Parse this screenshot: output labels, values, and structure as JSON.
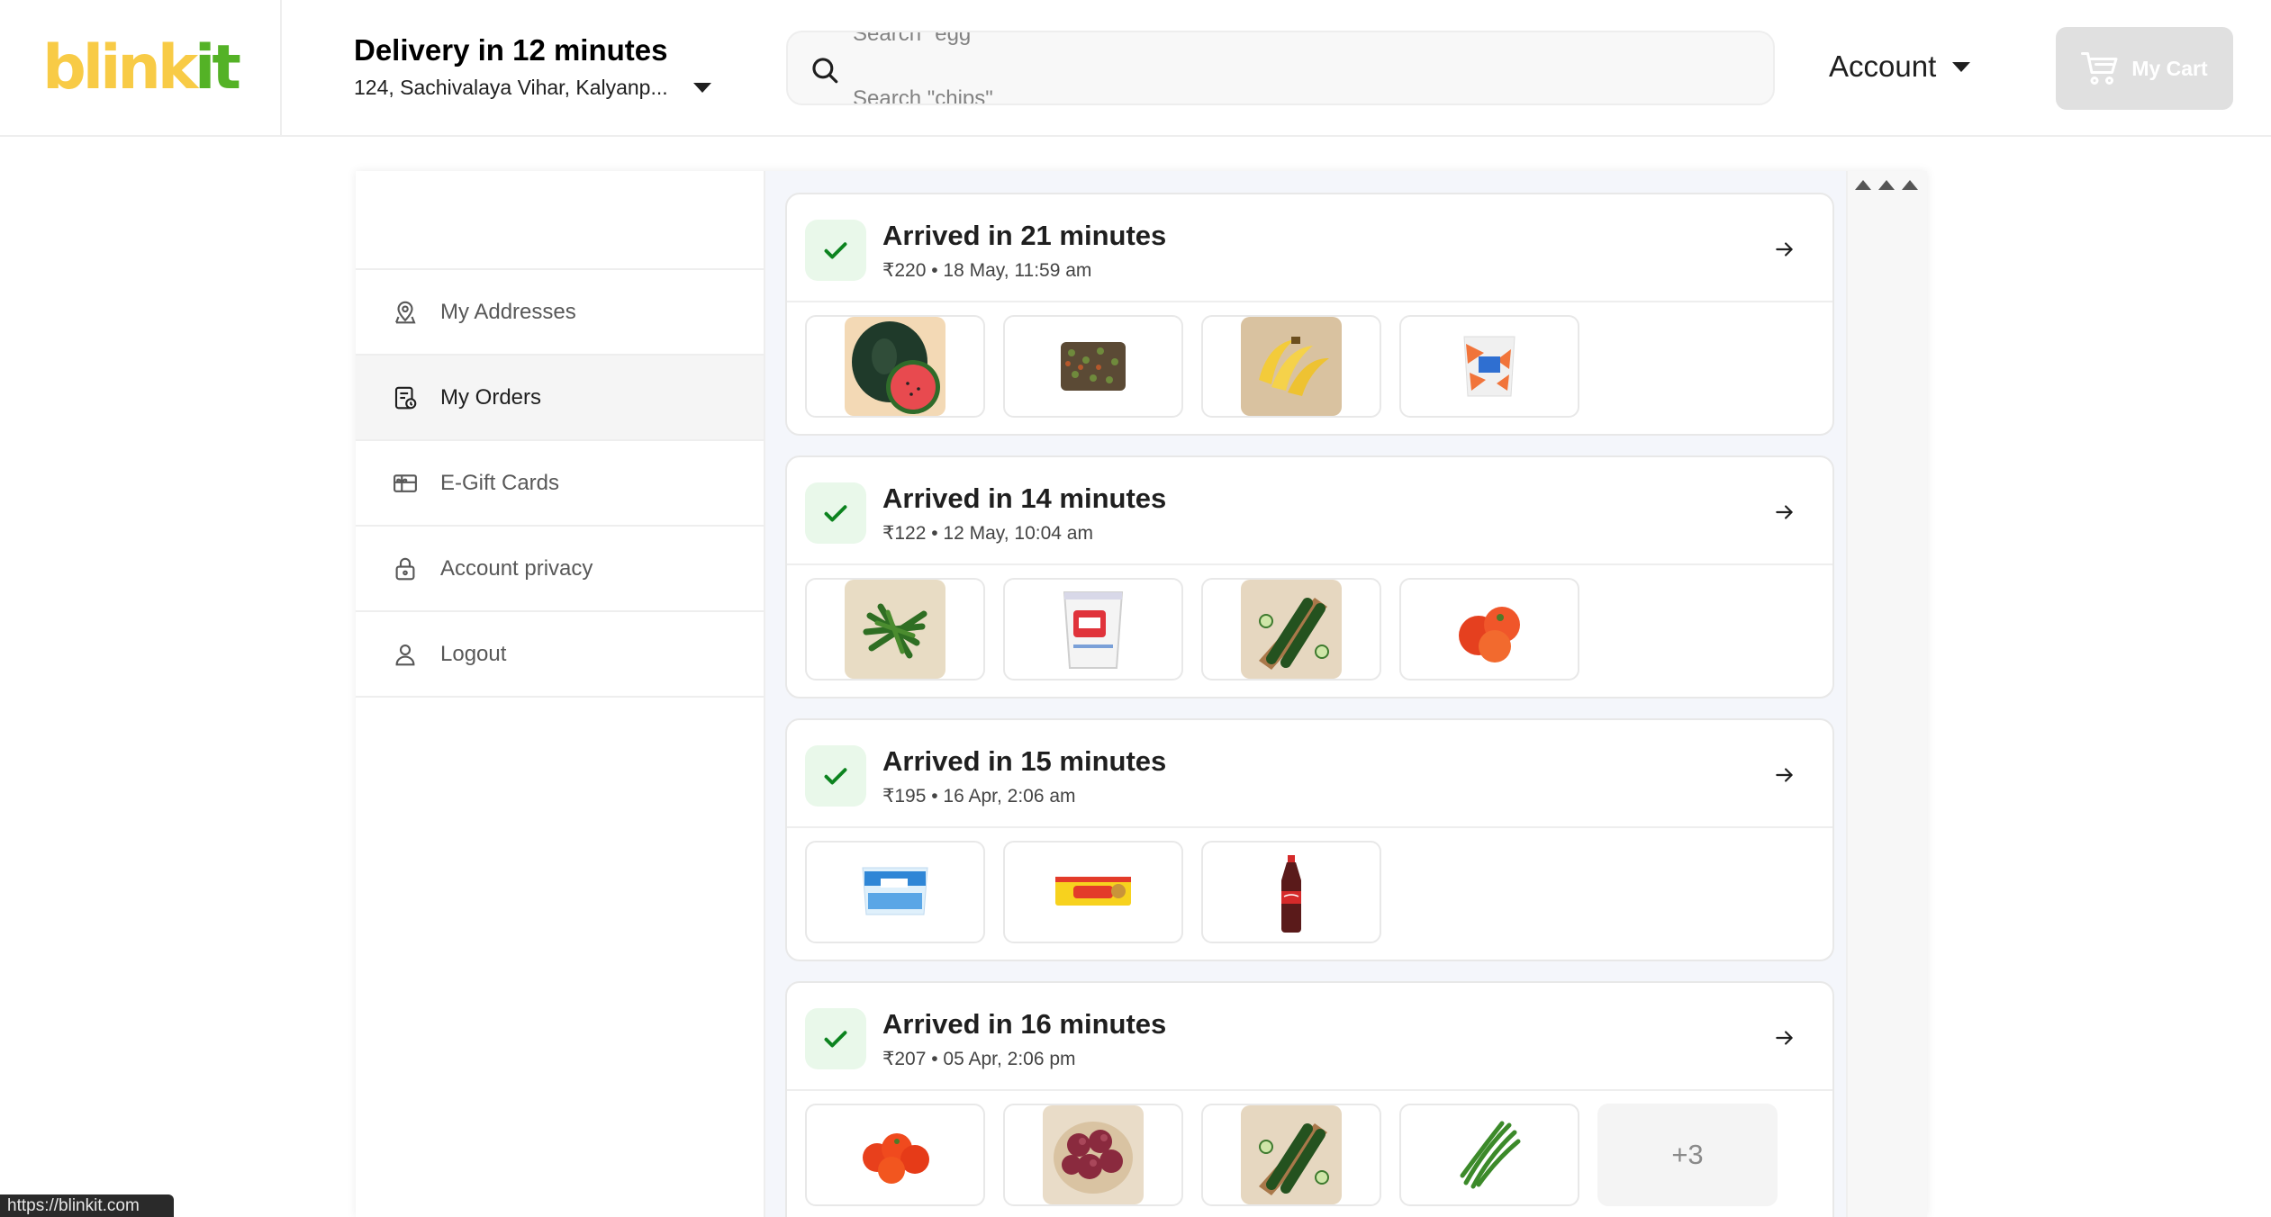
{
  "header": {
    "logo_left": "blink",
    "logo_right": "it",
    "delivery_title": "Delivery in 12 minutes",
    "delivery_address": "124, Sachivalaya Vihar, Kalyanp...",
    "search_placeholder_prev": "Search \"egg\"",
    "search_placeholder_next": "Search \"chips\"",
    "account_label": "Account",
    "cart_label": "My Cart"
  },
  "sidebar": {
    "items": [
      {
        "label": "My Addresses",
        "icon": "address-pin-icon"
      },
      {
        "label": "My Orders",
        "icon": "orders-icon"
      },
      {
        "label": "E-Gift Cards",
        "icon": "gift-card-icon"
      },
      {
        "label": "Account privacy",
        "icon": "lock-icon"
      },
      {
        "label": "Logout",
        "icon": "user-icon"
      }
    ]
  },
  "orders": [
    {
      "title": "Arrived in 21 minutes",
      "subtitle": "₹220 • 18 May, 11:59 am",
      "items": [
        "watermelon",
        "chocolate-bar",
        "banana",
        "milk-pack"
      ],
      "more": ""
    },
    {
      "title": "Arrived in 14 minutes",
      "subtitle": "₹122 • 12 May, 10:04 am",
      "items": [
        "green-chilli",
        "curd-cup",
        "cucumber",
        "tomato"
      ],
      "more": ""
    },
    {
      "title": "Arrived in 15 minutes",
      "subtitle": "₹195 • 16 Apr, 2:06 am",
      "items": [
        "milk-pack-blue",
        "maggi-noodles",
        "coca-cola-bottle"
      ],
      "more": ""
    },
    {
      "title": "Arrived in 16 minutes",
      "subtitle": "₹207 • 05 Apr, 2:06 pm",
      "items": [
        "tomato-red",
        "onion",
        "cucumber",
        "green-beans"
      ],
      "more": "+3"
    }
  ],
  "status_url": "https://blinkit.com",
  "colors": {
    "brand_yellow": "#f8cb46",
    "brand_green": "#54b226",
    "success_green": "#0c831f"
  }
}
